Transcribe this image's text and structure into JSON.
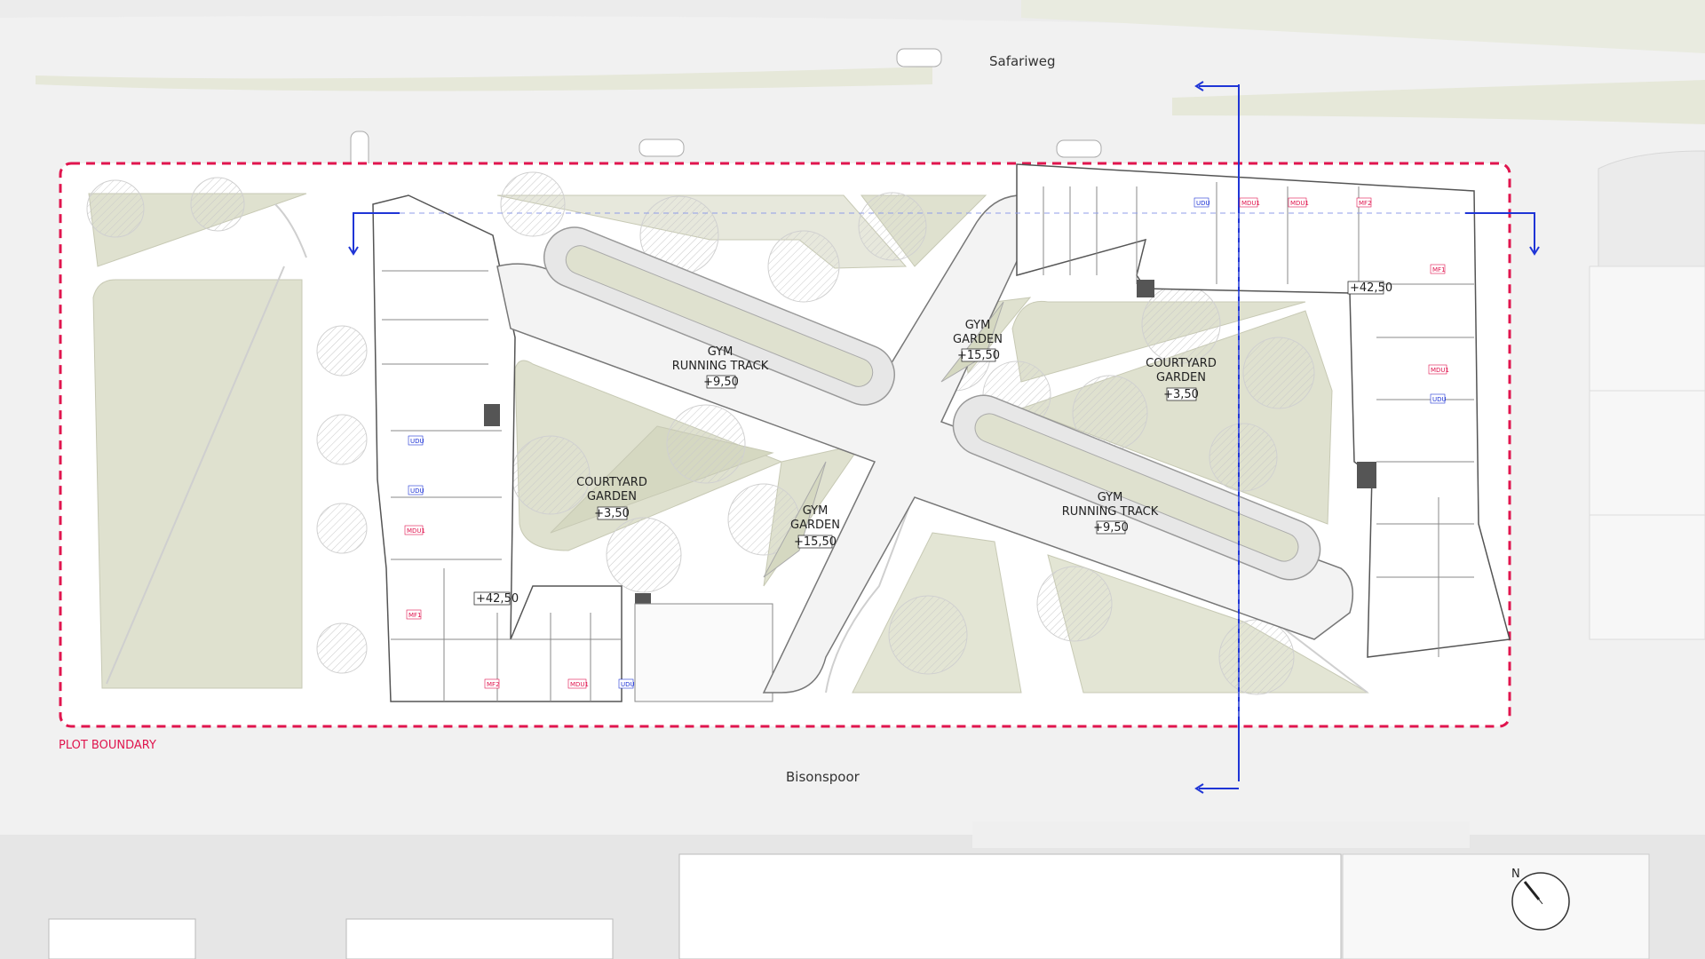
{
  "streets": {
    "north": "Safariweg",
    "south": "Bisonspoor"
  },
  "plot_boundary_label": "PLOT BOUNDARY",
  "areas": {
    "gym_track_west": {
      "line1": "GYM",
      "line2": "RUNNING TRACK",
      "level": "+9,50"
    },
    "gym_track_east": {
      "line1": "GYM",
      "line2": "RUNNING TRACK",
      "level": "+9,50"
    },
    "gym_garden_north": {
      "line1": "GYM",
      "line2": "GARDEN",
      "level": "+15,50"
    },
    "gym_garden_south": {
      "line1": "GYM",
      "line2": "GARDEN",
      "level": "+15,50"
    },
    "courtyard_west": {
      "line1": "COURTYARD",
      "line2": "GARDEN",
      "level": "+3,50"
    },
    "courtyard_east": {
      "line1": "COURTYARD",
      "line2": "GARDEN",
      "level": "+3,50"
    }
  },
  "building_levels": {
    "west": "+42,50",
    "east": "+42,50"
  },
  "unit_tags": {
    "west": [
      "UDU",
      "UDU",
      "MDU1",
      "MF1",
      "MF2",
      "MDU1",
      "UDU"
    ],
    "east": [
      "UDU",
      "MDU1",
      "MDU1",
      "MF2",
      "MF1",
      "MDU1",
      "UDU"
    ]
  },
  "compass_letter": "N",
  "colors": {
    "boundary": "#e0154e",
    "section_line": "#1f35d6",
    "garden": "#dfe1cf",
    "ground": "#f2f2f2",
    "plot_ground": "#ffffff",
    "tag_blue": "#1f35d6",
    "tag_red": "#e0154e"
  }
}
